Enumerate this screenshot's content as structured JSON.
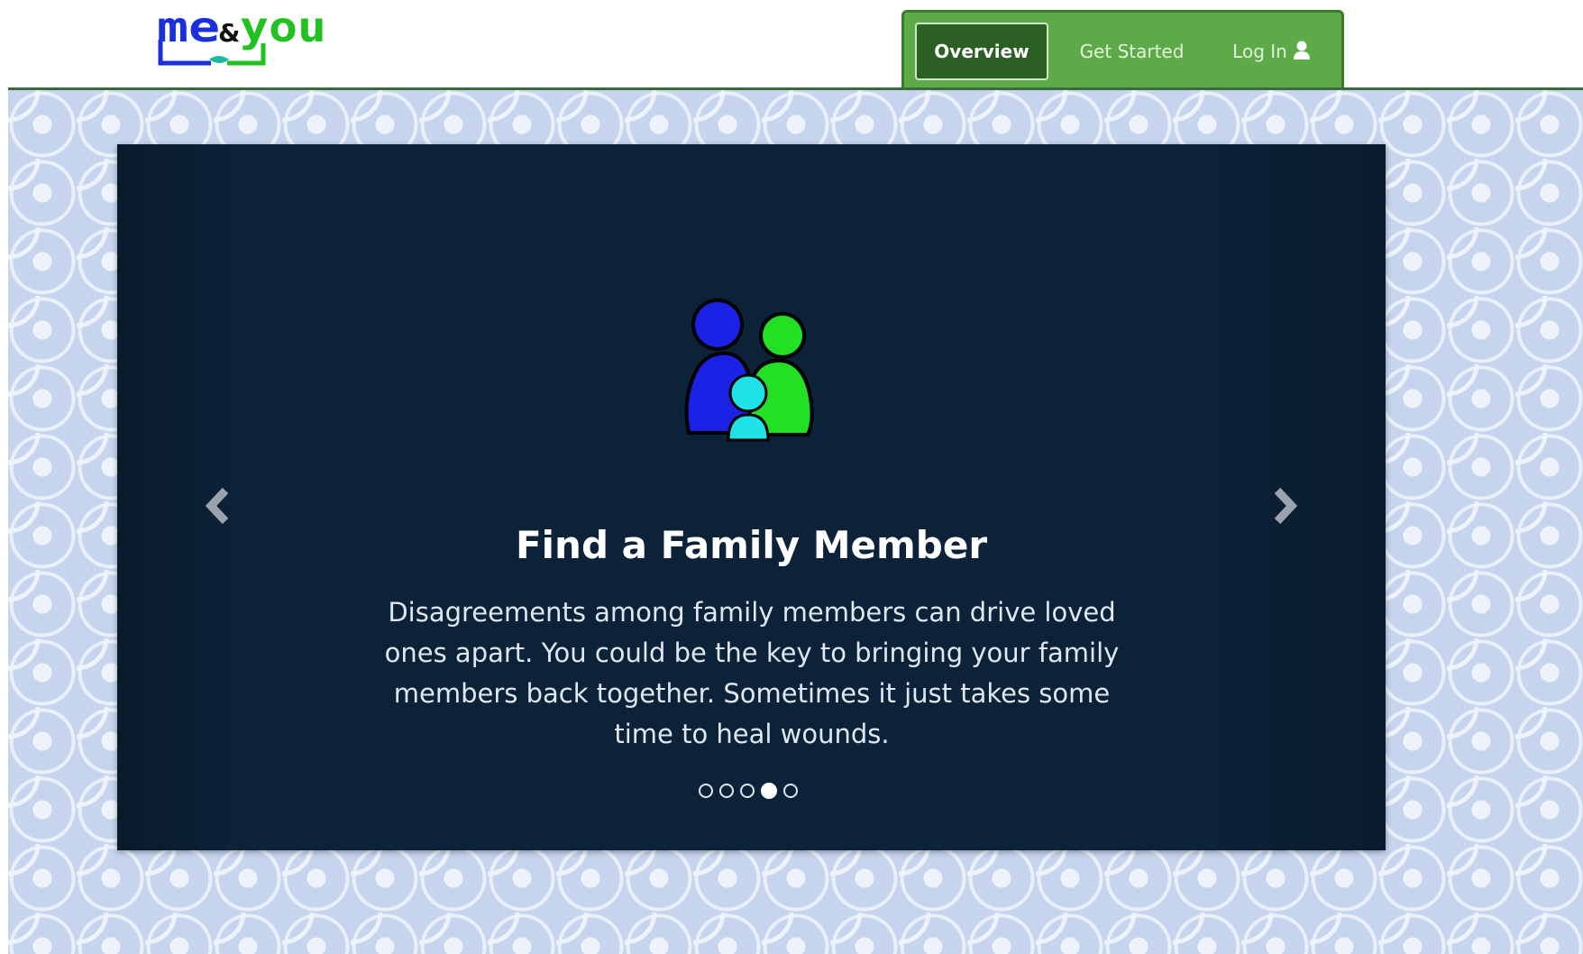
{
  "header": {
    "logo_text": "me&you",
    "nav": [
      {
        "label": "Overview",
        "active": true
      },
      {
        "label": "Get Started",
        "active": false
      },
      {
        "label": "Log In",
        "active": false,
        "icon": "user-icon"
      }
    ]
  },
  "carousel": {
    "slide": {
      "icon": "family-icon",
      "title": "Find a Family Member",
      "text": "Disagreements among family members can drive loved ones apart. You could be the key to bringing your family members back together. Sometimes it just takes some time to heal wounds."
    },
    "prev_icon": "chevron-left-icon",
    "next_icon": "chevron-right-icon",
    "indicator_count": 5,
    "active_indicator": 4
  },
  "colors": {
    "nav_bg": "#5dab48",
    "nav_active": "#2c5f24",
    "carousel_bg": "#0c2238",
    "pattern_bg": "#c6d4ee"
  }
}
